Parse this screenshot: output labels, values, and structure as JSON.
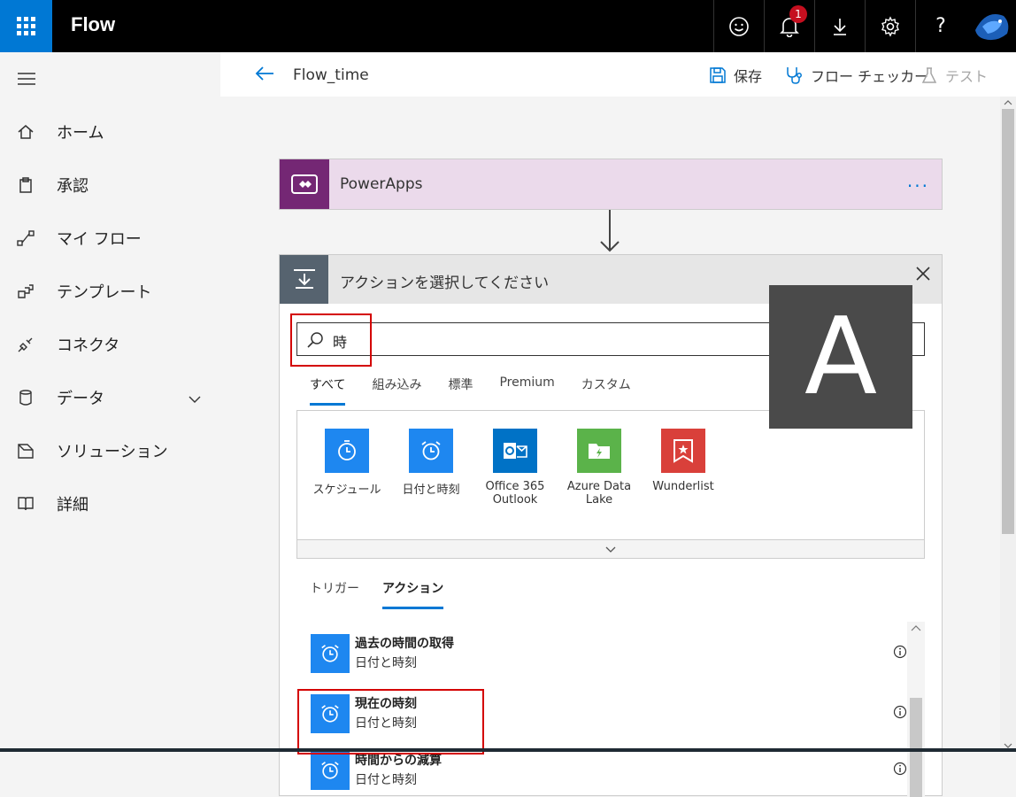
{
  "topbar": {
    "app_title": "Flow",
    "notification_count": "1",
    "help_label": "?"
  },
  "sidebar": {
    "items": [
      {
        "label": "ホーム",
        "icon": "home-icon"
      },
      {
        "label": "承認",
        "icon": "clipboard-icon"
      },
      {
        "label": "マイ フロー",
        "icon": "flow-icon"
      },
      {
        "label": "テンプレート",
        "icon": "template-icon"
      },
      {
        "label": "コネクタ",
        "icon": "plug-icon"
      },
      {
        "label": "データ",
        "icon": "database-icon"
      },
      {
        "label": "ソリューション",
        "icon": "solution-icon"
      },
      {
        "label": "詳細",
        "icon": "book-icon"
      }
    ]
  },
  "commandbar": {
    "flow_name": "Flow_time",
    "save_label": "保存",
    "checker_label": "フロー チェッカー",
    "test_label": "テスト"
  },
  "powerapps_card": {
    "title": "PowerApps",
    "more": "···"
  },
  "action_panel": {
    "title": "アクションを選択してください",
    "search_value": "時",
    "tabs": [
      "すべて",
      "組み込み",
      "標準",
      "Premium",
      "カスタム"
    ],
    "connectors": [
      {
        "line1": "スケジュール",
        "line2": "",
        "color": "#1e87f0"
      },
      {
        "line1": "日付と時刻",
        "line2": "",
        "color": "#1e87f0"
      },
      {
        "line1": "Office 365",
        "line2": "Outlook",
        "color": "#0072c6"
      },
      {
        "line1": "Azure Data",
        "line2": "Lake",
        "color": "#5bb34a"
      },
      {
        "line1": "Wunderlist",
        "line2": "",
        "color": "#d9403a"
      }
    ],
    "subtabs": [
      "トリガー",
      "アクション"
    ],
    "actions": [
      {
        "name": "過去の時間の取得",
        "sub": "日付と時刻"
      },
      {
        "name": "現在の時刻",
        "sub": "日付と時刻"
      },
      {
        "name": "時間からの減算",
        "sub": "日付と時刻"
      }
    ]
  },
  "overlay": {
    "letter": "A"
  },
  "colors": {
    "accent": "#0078d4",
    "highlight": "#d40000",
    "powerapps": "#742774"
  }
}
